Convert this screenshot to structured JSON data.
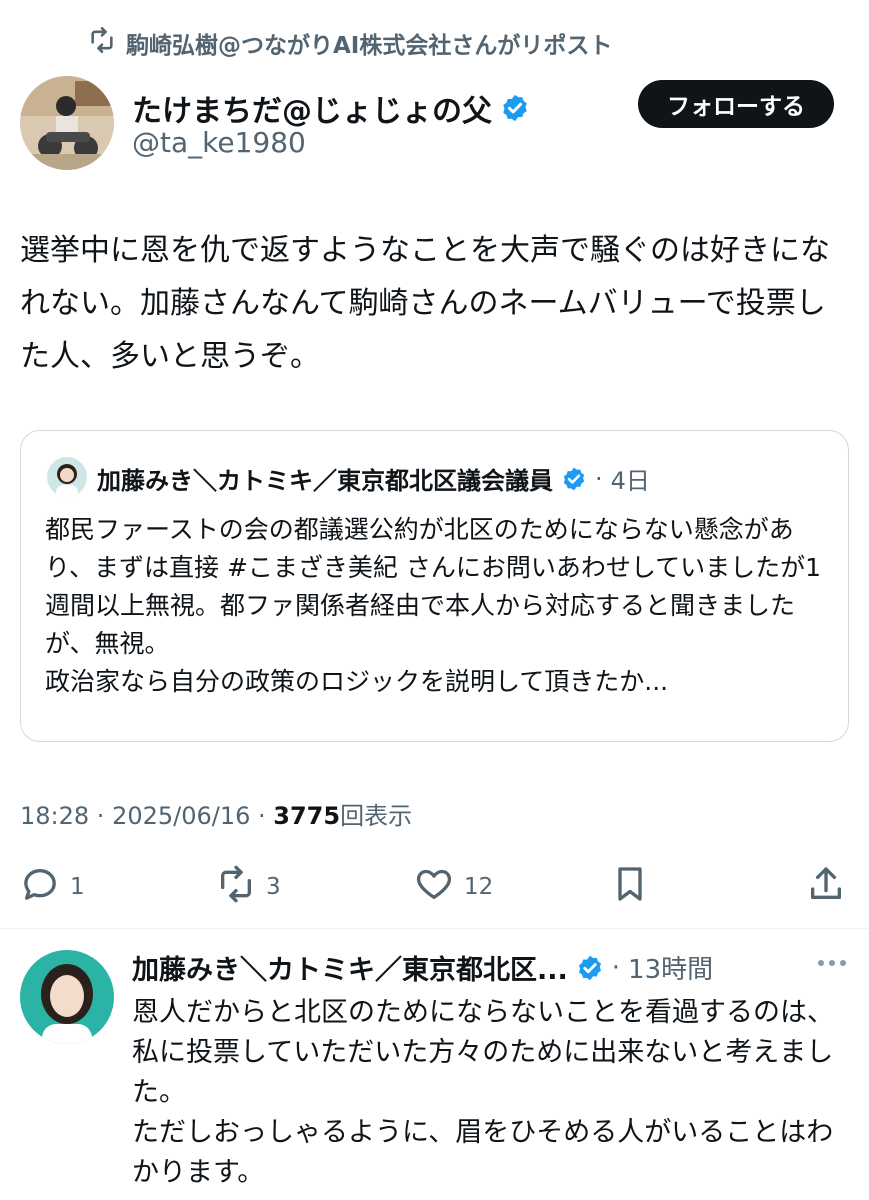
{
  "repost": {
    "text": "駒崎弘樹@つながりAI株式会社さんがリポスト",
    "icon": "repost-icon"
  },
  "tweet": {
    "author_name": "たけまちだ@じょじょの父",
    "handle": "@ta_ke1980",
    "follow_label": "フォローする",
    "text": "選挙中に恩を仇で返すようなことを大声で騒ぐのは好きになれない。加藤さんなんて駒崎さんのネームバリューで投票した人、多いと思うぞ。",
    "time": "18:28",
    "date": "2025/06/16",
    "views_count": "3775",
    "views_label": "回表示",
    "sep": " · ",
    "reply_count": "1",
    "repost_count": "3",
    "like_count": "12"
  },
  "quote": {
    "author_name": "加藤みき＼カトミキ／東京都北区議会議員",
    "sep": "·",
    "age": "4日",
    "text": "都民ファーストの会の都議選公約が北区のためにならない懸念があり、まずは直接 #こまざき美紀 さんにお問いあわせしていましたが1週間以上無視。都ファ関係者経由で本人から対応すると聞きましたが、無視。\n政治家なら自分の政策のロジックを説明して頂きたか..."
  },
  "reply": {
    "author_name": "加藤みき＼カトミキ／東京都北区...",
    "sep": "·",
    "age": "13時間",
    "text": "恩人だからと北区のためにならないことを看過するのは、私に投票していただいた方々のために出来ないと考えました。\nただしおっしゃるように、眉をひそめる人がいることはわかります。"
  },
  "colors": {
    "verified": "#1d9bf0",
    "secondary": "#536471",
    "primary": "#0f1419",
    "border": "#cfd9de"
  }
}
